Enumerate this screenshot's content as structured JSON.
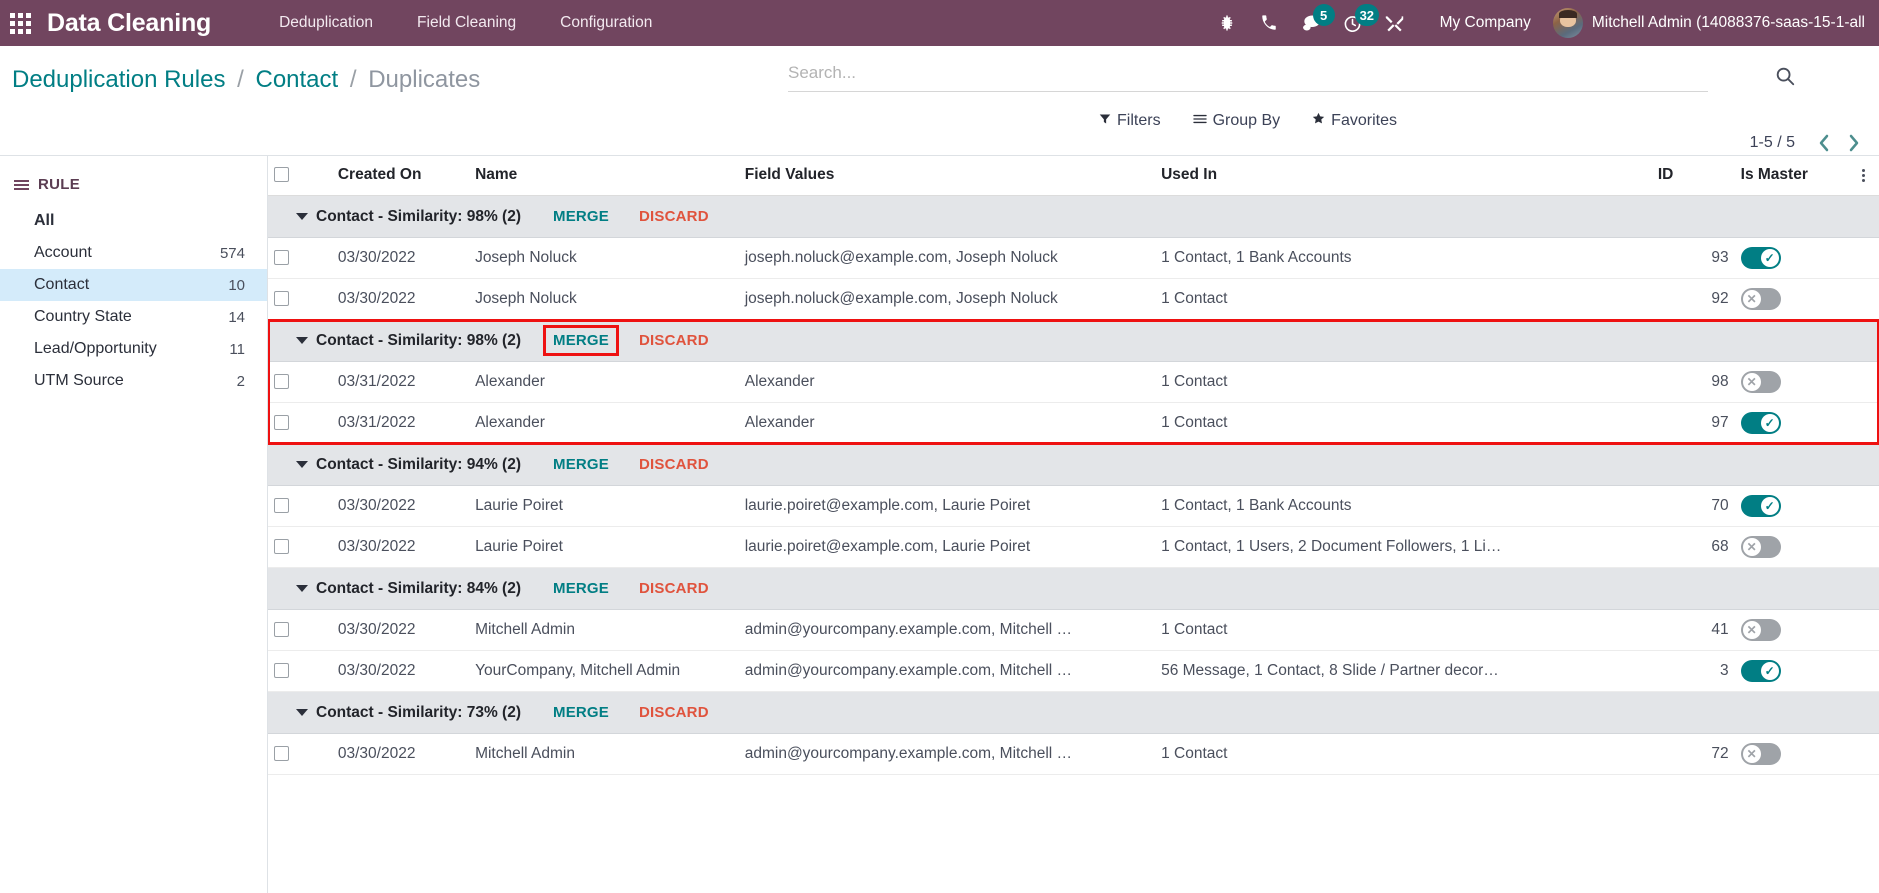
{
  "navbar": {
    "apps_icon": "apps-grid-icon",
    "app_title": "Data Cleaning",
    "menu": [
      {
        "label": "Deduplication"
      },
      {
        "label": "Field Cleaning"
      },
      {
        "label": "Configuration"
      }
    ],
    "icons": [
      {
        "name": "bug-icon",
        "badge": ""
      },
      {
        "name": "phone-icon",
        "badge": ""
      },
      {
        "name": "chat-icon",
        "badge": "5"
      },
      {
        "name": "activity-clock-icon",
        "badge": "32"
      },
      {
        "name": "tools-icon",
        "badge": ""
      }
    ],
    "company": "My Company",
    "user": "Mitchell Admin (14088376-saas-15-1-all",
    "bg_color": "#71455f",
    "badge_color": "#017e84"
  },
  "breadcrumb": {
    "root": "Deduplication Rules",
    "sep": "/",
    "parent": "Contact",
    "current": "Duplicates",
    "link_color": "#017e84"
  },
  "search": {
    "placeholder": "Search...",
    "value": "",
    "icon": "search-icon"
  },
  "controls": {
    "filters": "Filters",
    "group_by": "Group By",
    "favorites": "Favorites",
    "filters_icon": "filter-funnel-icon",
    "group_by_icon": "group-lines-icon",
    "favorites_icon": "star-icon"
  },
  "pager": {
    "count": "1-5 / 5",
    "prev_icon": "chevron-left-icon",
    "next_icon": "chevron-right-icon"
  },
  "sidebar": {
    "title": "RULE",
    "menu_icon": "hamburger-icon",
    "items": [
      {
        "label": "All",
        "count": "",
        "active": false,
        "bold": true
      },
      {
        "label": "Account",
        "count": "574",
        "active": false,
        "bold": false
      },
      {
        "label": "Contact",
        "count": "10",
        "active": true,
        "bold": false
      },
      {
        "label": "Country State",
        "count": "14",
        "active": false,
        "bold": false
      },
      {
        "label": "Lead/Opportunity",
        "count": "11",
        "active": false,
        "bold": false
      },
      {
        "label": "UTM Source",
        "count": "2",
        "active": false,
        "bold": false
      }
    ]
  },
  "table": {
    "columns": [
      {
        "key": "created_on",
        "label": "Created On"
      },
      {
        "key": "name",
        "label": "Name"
      },
      {
        "key": "field_values",
        "label": "Field Values"
      },
      {
        "key": "used_in",
        "label": "Used In"
      },
      {
        "key": "id",
        "label": "ID"
      },
      {
        "key": "is_master",
        "label": "Is Master"
      }
    ],
    "merge_label": "MERGE",
    "discard_label": "DISCARD",
    "groups": [
      {
        "label": "Contact - Similarity: 98% (2)",
        "highlighted": false,
        "merge_highlighted": false,
        "rows": [
          {
            "created_on": "03/30/2022",
            "name": "Joseph Noluck",
            "field_values": "joseph.noluck@example.com, Joseph Noluck",
            "used_in": "1 Contact, 1 Bank Accounts",
            "id": "93",
            "is_master": true
          },
          {
            "created_on": "03/30/2022",
            "name": "Joseph Noluck",
            "field_values": "joseph.noluck@example.com, Joseph Noluck",
            "used_in": "1 Contact",
            "id": "92",
            "is_master": false
          }
        ]
      },
      {
        "label": "Contact - Similarity: 98% (2)",
        "highlighted": true,
        "merge_highlighted": true,
        "rows": [
          {
            "created_on": "03/31/2022",
            "name": "Alexander",
            "field_values": "Alexander",
            "used_in": "1 Contact",
            "id": "98",
            "is_master": false
          },
          {
            "created_on": "03/31/2022",
            "name": "Alexander",
            "field_values": "Alexander",
            "used_in": "1 Contact",
            "id": "97",
            "is_master": true
          }
        ]
      },
      {
        "label": "Contact - Similarity: 94% (2)",
        "highlighted": false,
        "merge_highlighted": false,
        "rows": [
          {
            "created_on": "03/30/2022",
            "name": "Laurie Poiret",
            "field_values": "laurie.poiret@example.com, Laurie Poiret",
            "used_in": "1 Contact, 1 Bank Accounts",
            "id": "70",
            "is_master": true
          },
          {
            "created_on": "03/30/2022",
            "name": "Laurie Poiret",
            "field_values": "laurie.poiret@example.com, Laurie Poiret",
            "used_in": "1 Contact, 1 Users, 2 Document Followers, 1 Li…",
            "id": "68",
            "is_master": false
          }
        ]
      },
      {
        "label": "Contact - Similarity: 84% (2)",
        "highlighted": false,
        "merge_highlighted": false,
        "rows": [
          {
            "created_on": "03/30/2022",
            "name": "Mitchell Admin",
            "field_values": "admin@yourcompany.example.com, Mitchell …",
            "used_in": "1 Contact",
            "id": "41",
            "is_master": false
          },
          {
            "created_on": "03/30/2022",
            "name": "YourCompany, Mitchell Admin",
            "field_values": "admin@yourcompany.example.com, Mitchell …",
            "used_in": "56 Message, 1 Contact, 8 Slide / Partner decor…",
            "id": "3",
            "is_master": true
          }
        ]
      },
      {
        "label": "Contact - Similarity: 73% (2)",
        "highlighted": false,
        "merge_highlighted": false,
        "rows": [
          {
            "created_on": "03/30/2022",
            "name": "Mitchell Admin",
            "field_values": "admin@yourcompany.example.com, Mitchell …",
            "used_in": "1 Contact",
            "id": "72",
            "is_master": false
          }
        ]
      }
    ]
  },
  "colors": {
    "toggle_on": "#017e84",
    "toggle_off": "#9fa3a8",
    "highlight_red": "#ee1111",
    "discard_red": "#e0533d",
    "sidebar_active": "#d4ebfa"
  }
}
